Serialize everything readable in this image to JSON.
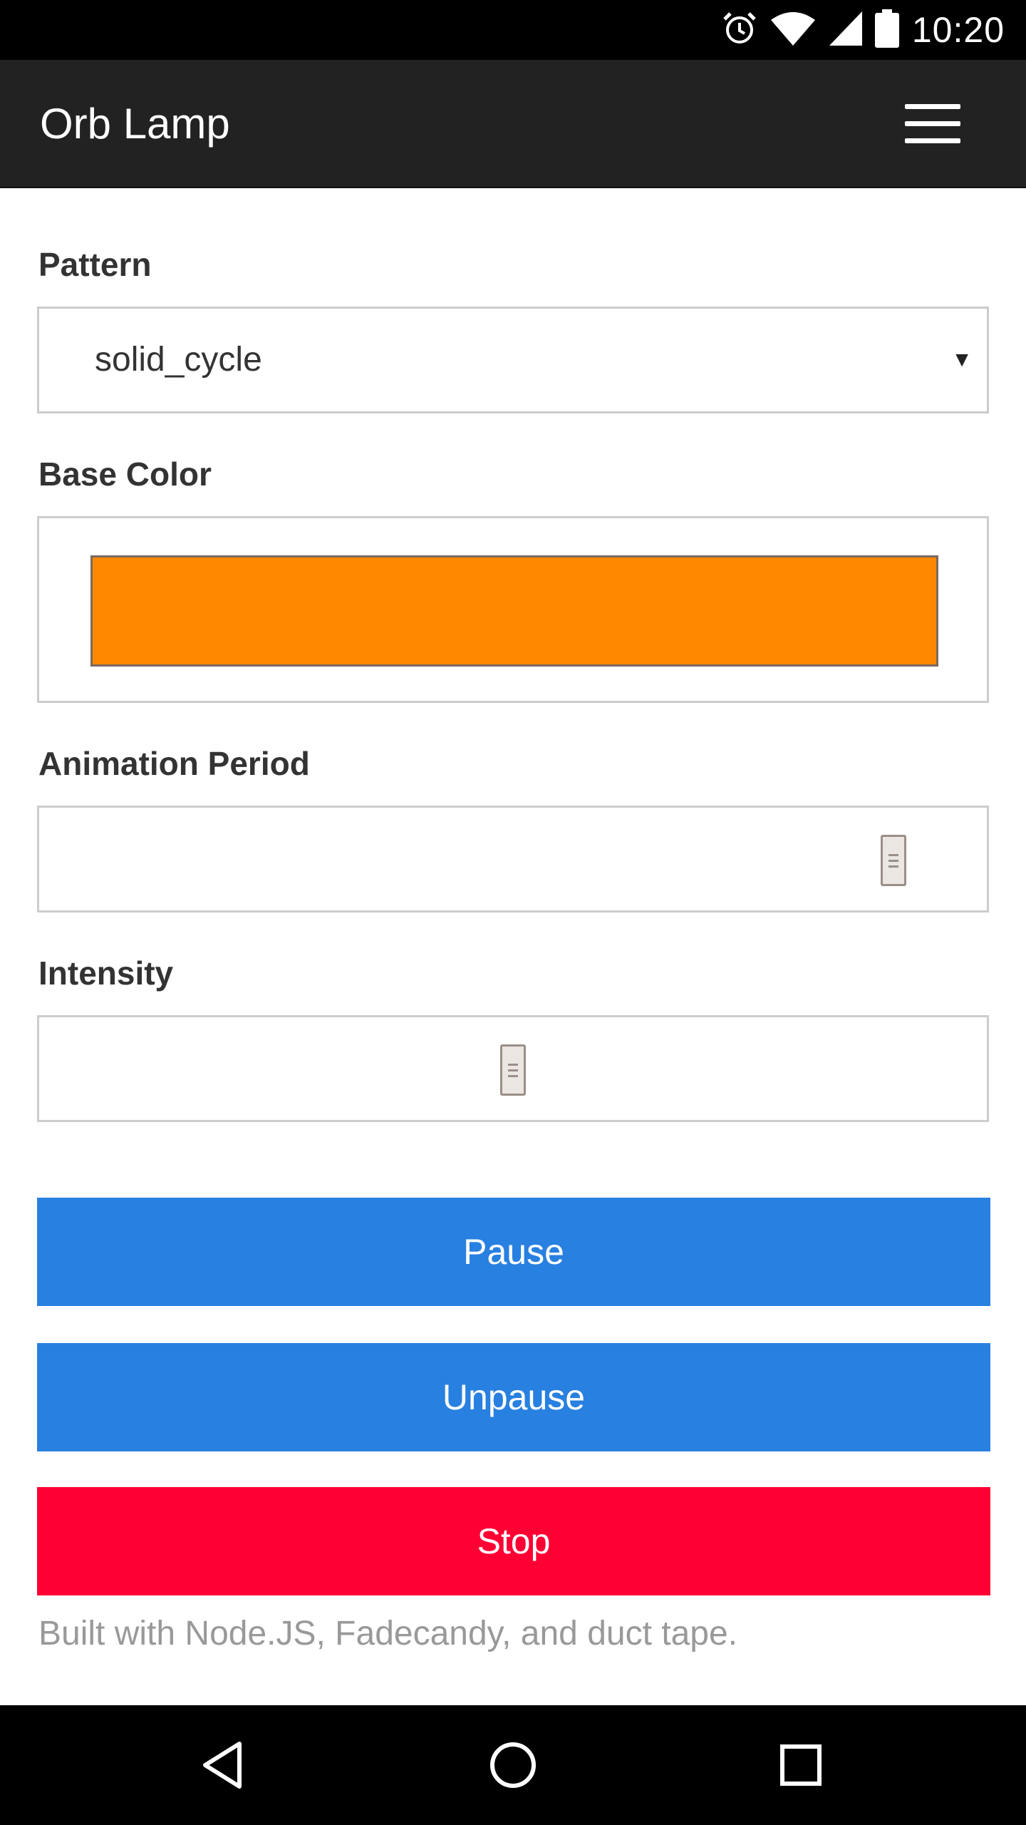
{
  "status_bar": {
    "time": "10:20",
    "icons": [
      "alarm-icon",
      "wifi-icon",
      "signal-icon",
      "battery-icon"
    ]
  },
  "app_bar": {
    "title": "Orb Lamp",
    "menu_icon": "hamburger-menu-icon"
  },
  "form": {
    "pattern": {
      "label": "Pattern",
      "value": "solid_cycle"
    },
    "base_color": {
      "label": "Base Color",
      "value": "#ff8800"
    },
    "animation_period": {
      "label": "Animation Period",
      "level": 0.93
    },
    "intensity": {
      "label": "Intensity",
      "level": 0.5
    }
  },
  "buttons": {
    "pause": {
      "label": "Pause",
      "color": "#2880e0"
    },
    "unpause": {
      "label": "Unpause",
      "color": "#2880e0"
    },
    "stop": {
      "label": "Stop",
      "color": "#ff0035"
    }
  },
  "footer": {
    "text": "Built with Node.JS, Fadecandy, and duct tape."
  },
  "nav_bar": {
    "icons": [
      "back-icon",
      "home-icon",
      "recents-icon"
    ]
  }
}
